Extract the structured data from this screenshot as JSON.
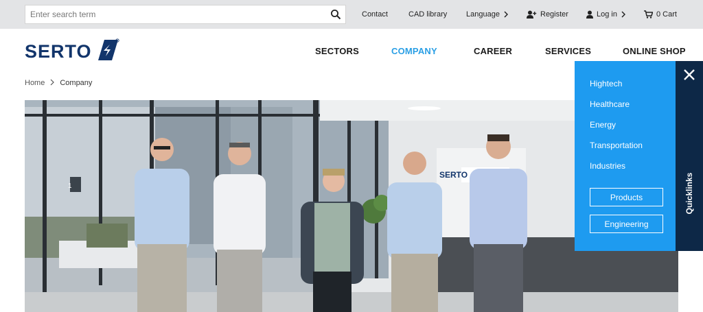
{
  "search": {
    "placeholder": "Enter search term"
  },
  "utility": {
    "contact": "Contact",
    "cad_library": "CAD library",
    "language": "Language",
    "register": "Register",
    "login": "Log in",
    "cart": "0 Cart"
  },
  "brand": {
    "name": "SERTO",
    "color": "#12356b"
  },
  "nav": {
    "sectors": "SECTORS",
    "company": "COMPANY",
    "career": "CAREER",
    "services": "SERVICES",
    "online_shop": "ONLINE SHOP",
    "active_color": "#2a9fe5"
  },
  "breadcrumb": {
    "home": "Home",
    "current": "Company"
  },
  "hero": {
    "sign_text": "SERTO",
    "door_number": "1"
  },
  "quicklinks": {
    "title": "Quicklinks",
    "items": [
      "Hightech",
      "Healthcare",
      "Energy",
      "Transportation",
      "Industries"
    ],
    "buttons": [
      "Products",
      "Engineering"
    ],
    "panel_color": "#1e9bf0",
    "tab_color": "#0d2847"
  }
}
